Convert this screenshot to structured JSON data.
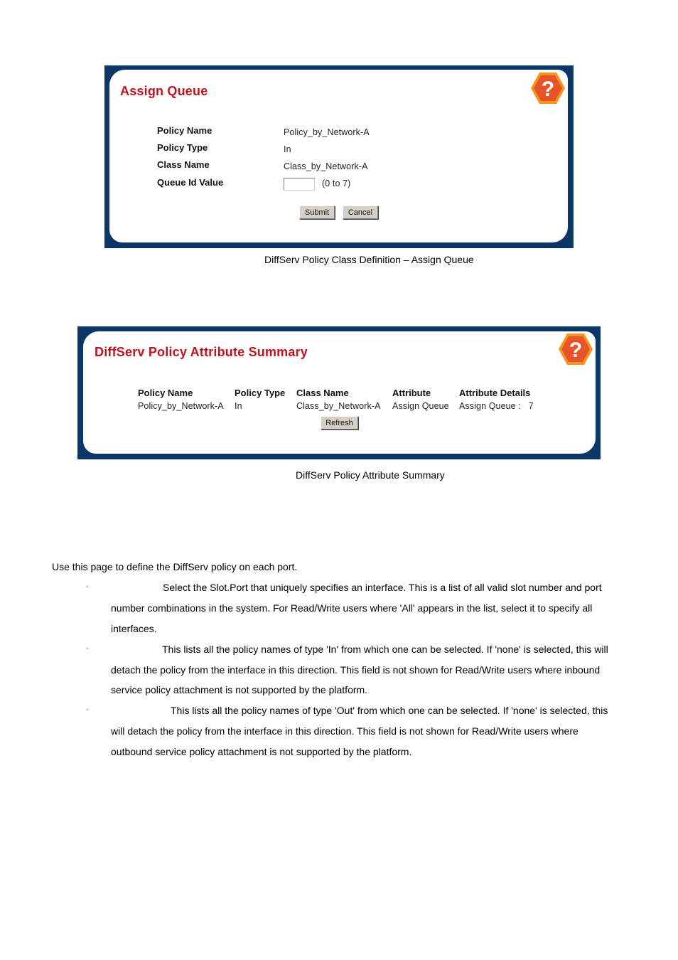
{
  "assign_queue": {
    "title": "Assign Queue",
    "help_icon": "help-question-icon",
    "fields": [
      {
        "label": "Policy Name",
        "value": "Policy_by_Network-A"
      },
      {
        "label": "Policy Type",
        "value": "In"
      },
      {
        "label": "Class Name",
        "value": "Class_by_Network-A"
      },
      {
        "label": "Queue Id Value",
        "value": ""
      }
    ],
    "queue_id_input": {
      "value": "",
      "range_hint": "(0 to 7)"
    },
    "submit_label": "Submit",
    "cancel_label": "Cancel",
    "caption": "DiffServ Policy Class Definition – Assign Queue"
  },
  "attribute_summary": {
    "title": "DiffServ Policy Attribute Summary",
    "help_icon": "help-question-icon",
    "columns": [
      "Policy Name",
      "Policy Type",
      "Class Name",
      "Attribute",
      "Attribute Details"
    ],
    "rows": [
      [
        "Policy_by_Network-A",
        "In",
        "Class_by_Network-A",
        "Assign Queue",
        "Assign Queue :   7"
      ]
    ],
    "refresh_label": "Refresh",
    "caption": "DiffServ Policy Attribute Summary"
  },
  "body_text": {
    "intro": "Use this page to define the DiffServ policy on each port.",
    "bullets": [
      {
        "lines": [
          "Select the Slot.Port that uniquely specifies an interface. This is a list of all valid slot number and port",
          "number combinations in the system. For Read/Write users where 'All' appears in the list, select it to specify all",
          "interfaces."
        ]
      },
      {
        "lines": [
          "This lists all the policy names of type 'In' from which one can be selected. If 'none' is selected, this will",
          "detach the policy from the interface in this direction. This field is not shown for Read/Write users where inbound",
          "service policy attachment is not supported by the platform."
        ]
      },
      {
        "lines": [
          "This lists all the policy names of type 'Out' from which one can be selected. If 'none' is selected, this",
          "will detach the policy from the interface in this direction. This field is not shown for Read/Write users where",
          "outbound service policy attachment is not supported by the platform."
        ]
      }
    ],
    "bullet_glyph": "◦"
  }
}
